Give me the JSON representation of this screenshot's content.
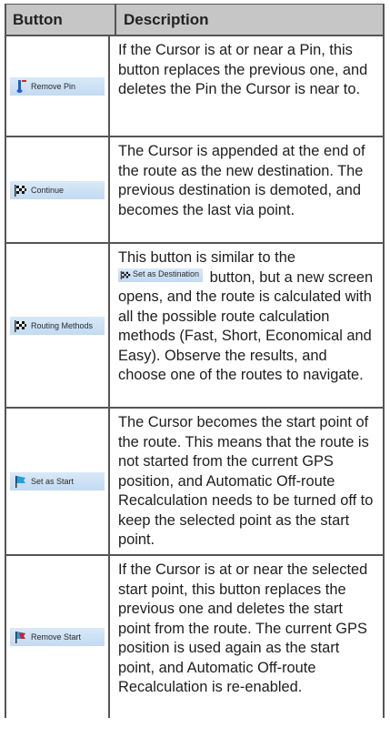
{
  "header": {
    "button_col": "Button",
    "description_col": "Description"
  },
  "rows": [
    {
      "button_label": "Remove Pin",
      "button_icon": "pin-remove-icon",
      "description": "If the Cursor is at or near a Pin, this button replaces the previous one, and deletes the Pin the Cursor is near to."
    },
    {
      "button_label": "Continue",
      "button_icon": "checkered-flag-icon",
      "description": "The Cursor is appended at the end of the route as the new destination. The previous destination is demoted, and becomes the last via point."
    },
    {
      "button_label": "Routing Methods",
      "button_icon": "checkered-flag-icon",
      "description_before": "This button is similar to the",
      "inline_button_label": "Set as Destination",
      "description_after": "button, but a new screen opens, and the route is calculated with all the possible route calculation methods (Fast, Short, Economical and Easy). Observe the results, and choose one of the routes to navigate."
    },
    {
      "button_label": "Set as Start",
      "button_icon": "start-flag-icon",
      "description": "The Cursor becomes the start point of the route. This means that the route is not started from the current GPS position, and Automatic Off-route Recalculation needs to be turned off to keep the selected point as the start point."
    },
    {
      "button_label": "Remove Start",
      "button_icon": "start-flag-remove-icon",
      "description": "If the Cursor is at or near the selected start point, this button replaces the previous one and deletes the start point from the route. The current GPS position is used again as the start point, and Automatic Off-route Recalculation is re-enabled."
    }
  ]
}
